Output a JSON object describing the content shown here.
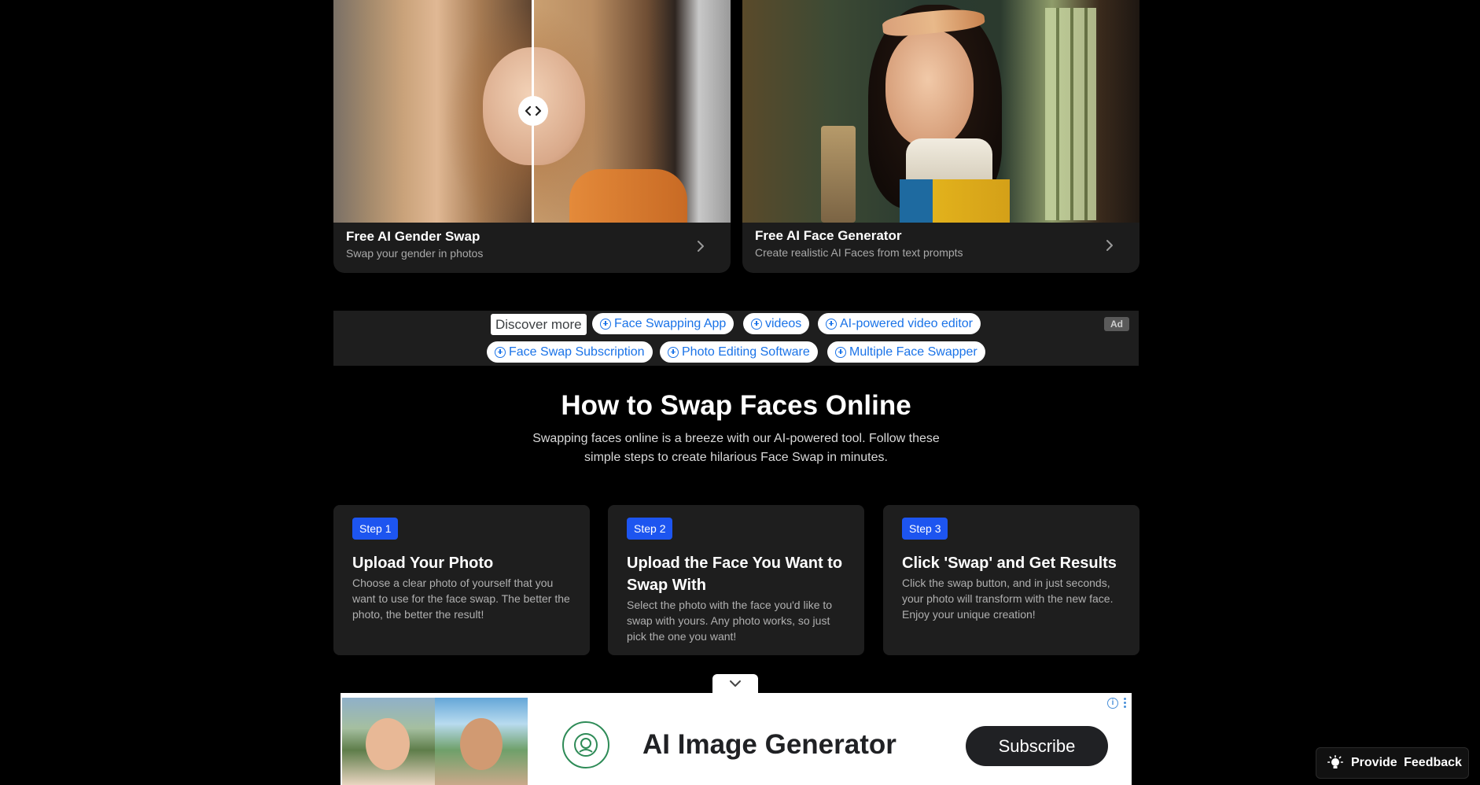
{
  "cards": [
    {
      "title": "Free AI Gender Swap",
      "subtitle": "Swap your gender in photos"
    },
    {
      "title": "Free AI Face Generator",
      "subtitle": "Create realistic AI Faces from text prompts"
    }
  ],
  "discover": {
    "label": "Discover more",
    "pills": [
      "Face Swapping App",
      "videos",
      "AI-powered video editor",
      "Face Swap Subscription",
      "Photo Editing Software",
      "Multiple Face Swapper"
    ],
    "ad_badge": "Ad"
  },
  "howto": {
    "title": "How to Swap Faces Online",
    "description": "Swapping faces online is a breeze with our AI-powered tool. Follow these simple steps to create hilarious Face Swap in minutes."
  },
  "steps": [
    {
      "badge": "Step 1",
      "title": "Upload Your Photo",
      "description": "Choose a clear photo of yourself that you want to use for the face swap. The better the photo, the better the result!"
    },
    {
      "badge": "Step 2",
      "title": "Upload the Face You Want to Swap With",
      "description": "Select the photo with the face you'd like to swap with yours. Any photo works, so just pick the one you want!"
    },
    {
      "badge": "Step 3",
      "title": "Click 'Swap' and Get Results",
      "description": "Click the swap button, and in just seconds, your photo will transform with the new face. Enjoy your unique creation!"
    }
  ],
  "ad": {
    "headline": "AI Image Generator",
    "cta": "Subscribe",
    "info_glyph": "i"
  },
  "feedback": {
    "label": "Provide Feedback"
  },
  "colors": {
    "accent": "#1d55f0",
    "card_bg": "#1c1c1c",
    "page_bg": "#000000"
  }
}
